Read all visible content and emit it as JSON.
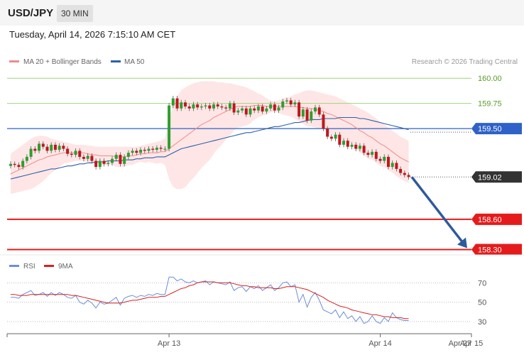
{
  "header": {
    "symbol": "USD/JPY",
    "timeframe": "30 MIN",
    "datetime": "Tuesday, April 14, 2026 7:15:10 AM CET"
  },
  "legend": {
    "ma20_label": "MA 20 + Bollinger Bands",
    "ma50_label": "MA 50",
    "copyright": "Research © 2026 Trading Central",
    "rsi_label": "RSI",
    "rsi_ma_label": "9MA"
  },
  "colors": {
    "ma20": "#f08a8a",
    "ma50": "#2e5fa8",
    "band_fill": "#fddede",
    "bull": "#2e9e2e",
    "bear": "#c0161c",
    "resistance": "#9ed47e",
    "pivot": "#2f62c8",
    "support": "#e51b1b",
    "last_price": "#333333",
    "arrow": "#2e5a9c",
    "rsi": "#6a8fd8",
    "rsi_ma": "#d92020"
  },
  "chart_data": [
    {
      "type": "candlestick",
      "symbol": "USD/JPY",
      "timeframe": "30 MIN",
      "y_ticks": [
        160.0,
        159.75,
        159.5,
        159.02,
        158.6,
        158.3
      ],
      "ylim": [
        158.24,
        160.1
      ],
      "levels": [
        {
          "value": 160.0,
          "kind": "resistance",
          "label": "160.00"
        },
        {
          "value": 159.75,
          "kind": "resistance",
          "label": "159.75"
        },
        {
          "value": 159.5,
          "kind": "pivot",
          "label": "159.50"
        },
        {
          "value": 159.02,
          "kind": "last",
          "label": "159.02"
        },
        {
          "value": 158.6,
          "kind": "support",
          "label": "158.60"
        },
        {
          "value": 158.3,
          "kind": "support",
          "label": "158.30"
        }
      ],
      "x_tick_labels": [
        "Apr 13",
        "Apr 14",
        "Apr 15",
        "Apr 27"
      ],
      "x_tick_bar_index": [
        39,
        91,
        105,
        119
      ],
      "closes": [
        159.15,
        159.14,
        159.12,
        159.18,
        159.22,
        159.3,
        159.28,
        159.35,
        159.32,
        159.28,
        159.34,
        159.29,
        159.33,
        159.3,
        159.25,
        159.24,
        159.28,
        159.22,
        159.2,
        159.23,
        159.18,
        159.12,
        159.18,
        159.15,
        159.16,
        159.2,
        159.24,
        159.15,
        159.22,
        159.26,
        159.28,
        159.26,
        159.29,
        159.28,
        159.3,
        159.29,
        159.31,
        159.3,
        159.3,
        159.73,
        159.8,
        159.7,
        159.76,
        159.72,
        159.7,
        159.74,
        159.71,
        159.72,
        159.73,
        159.7,
        159.74,
        159.72,
        159.71,
        159.7,
        159.75,
        159.66,
        159.68,
        159.7,
        159.64,
        159.7,
        159.68,
        159.72,
        159.67,
        159.7,
        159.74,
        159.68,
        159.71,
        159.77,
        159.78,
        159.74,
        159.76,
        159.62,
        159.69,
        159.58,
        159.67,
        159.71,
        159.64,
        159.5,
        159.42,
        159.4,
        159.44,
        159.34,
        159.38,
        159.32,
        159.34,
        159.3,
        159.33,
        159.26,
        159.24,
        159.27,
        159.2,
        159.18,
        159.22,
        159.12,
        159.16,
        159.1,
        159.06,
        159.04,
        159.02
      ],
      "ma20": [
        159.05,
        159.07,
        159.09,
        159.11,
        159.13,
        159.15,
        159.17,
        159.19,
        159.2,
        159.22,
        159.23,
        159.24,
        159.25,
        159.26,
        159.26,
        159.26,
        159.26,
        159.26,
        159.26,
        159.25,
        159.24,
        159.24,
        159.23,
        159.23,
        159.23,
        159.23,
        159.22,
        159.22,
        159.22,
        159.23,
        159.23,
        159.24,
        159.25,
        159.25,
        159.26,
        159.26,
        159.26,
        159.27,
        159.27,
        159.3,
        159.33,
        159.36,
        159.39,
        159.42,
        159.45,
        159.48,
        159.51,
        159.54,
        159.56,
        159.58,
        159.61,
        159.63,
        159.65,
        159.67,
        159.69,
        159.71,
        159.72,
        159.72,
        159.72,
        159.72,
        159.73,
        159.73,
        159.73,
        159.72,
        159.72,
        159.72,
        159.72,
        159.72,
        159.72,
        159.72,
        159.72,
        159.71,
        159.71,
        159.7,
        159.7,
        159.69,
        159.68,
        159.67,
        159.65,
        159.64,
        159.62,
        159.6,
        159.58,
        159.56,
        159.54,
        159.51,
        159.48,
        159.46,
        159.43,
        159.41,
        159.38,
        159.35,
        159.33,
        159.3,
        159.27,
        159.24,
        159.21,
        159.19,
        159.17
      ],
      "upper_band": [
        159.25,
        159.28,
        159.31,
        159.34,
        159.37,
        159.4,
        159.42,
        159.43,
        159.43,
        159.42,
        159.4,
        159.39,
        159.38,
        159.37,
        159.36,
        159.35,
        159.34,
        159.34,
        159.34,
        159.33,
        159.33,
        159.32,
        159.32,
        159.32,
        159.32,
        159.32,
        159.32,
        159.32,
        159.32,
        159.32,
        159.32,
        159.32,
        159.33,
        159.34,
        159.35,
        159.36,
        159.37,
        159.38,
        159.4,
        159.6,
        159.74,
        159.82,
        159.88,
        159.91,
        159.93,
        159.95,
        159.96,
        159.97,
        159.97,
        159.97,
        159.97,
        159.96,
        159.96,
        159.95,
        159.95,
        159.94,
        159.93,
        159.92,
        159.91,
        159.89,
        159.87,
        159.85,
        159.83,
        159.8,
        159.78,
        159.77,
        159.78,
        159.8,
        159.81,
        159.82,
        159.84,
        159.85,
        159.87,
        159.88,
        159.88,
        159.87,
        159.86,
        159.85,
        159.84,
        159.83,
        159.82,
        159.8,
        159.78,
        159.76,
        159.74,
        159.72,
        159.7,
        159.68,
        159.66,
        159.63,
        159.6,
        159.57,
        159.54,
        159.51,
        159.48,
        159.45,
        159.42,
        159.4,
        159.38
      ],
      "lower_band": [
        158.85,
        158.86,
        158.87,
        158.88,
        158.89,
        158.9,
        158.92,
        158.95,
        158.98,
        159.02,
        159.06,
        159.09,
        159.12,
        159.15,
        159.16,
        159.17,
        159.18,
        159.18,
        159.18,
        159.17,
        159.15,
        159.16,
        159.14,
        159.14,
        159.14,
        159.14,
        159.12,
        159.12,
        159.12,
        159.14,
        159.14,
        159.16,
        159.17,
        159.16,
        159.17,
        159.16,
        159.15,
        159.16,
        159.14,
        159.0,
        158.92,
        158.9,
        158.9,
        158.92,
        158.97,
        159.01,
        159.06,
        159.11,
        159.15,
        159.19,
        159.25,
        159.3,
        159.34,
        159.39,
        159.43,
        159.48,
        159.51,
        159.52,
        159.53,
        159.55,
        159.59,
        159.61,
        159.63,
        159.64,
        159.66,
        159.67,
        159.66,
        159.64,
        159.63,
        159.62,
        159.6,
        159.57,
        159.55,
        159.52,
        159.52,
        159.51,
        159.5,
        159.49,
        159.46,
        159.45,
        159.42,
        159.4,
        159.38,
        159.36,
        159.34,
        159.3,
        159.26,
        159.24,
        159.2,
        159.19,
        159.16,
        159.13,
        159.12,
        159.09,
        159.06,
        159.03,
        159.0,
        158.98,
        158.96
      ],
      "ma50": [
        159.0,
        159.01,
        159.02,
        159.03,
        159.04,
        159.05,
        159.06,
        159.07,
        159.08,
        159.09,
        159.1,
        159.1,
        159.11,
        159.12,
        159.13,
        159.13,
        159.14,
        159.15,
        159.15,
        159.16,
        159.16,
        159.17,
        159.17,
        159.17,
        159.18,
        159.18,
        159.18,
        159.18,
        159.19,
        159.19,
        159.19,
        159.2,
        159.2,
        159.21,
        159.21,
        159.21,
        159.22,
        159.22,
        159.22,
        159.24,
        159.26,
        159.28,
        159.3,
        159.31,
        159.32,
        159.33,
        159.34,
        159.35,
        159.36,
        159.37,
        159.38,
        159.39,
        159.4,
        159.41,
        159.42,
        159.43,
        159.44,
        159.45,
        159.46,
        159.46,
        159.47,
        159.48,
        159.49,
        159.5,
        159.51,
        159.52,
        159.52,
        159.53,
        159.54,
        159.55,
        159.56,
        159.56,
        159.57,
        159.58,
        159.59,
        159.59,
        159.59,
        159.6,
        159.6,
        159.6,
        159.6,
        159.61,
        159.61,
        159.61,
        159.61,
        159.61,
        159.6,
        159.6,
        159.59,
        159.58,
        159.57,
        159.56,
        159.55,
        159.54,
        159.53,
        159.52,
        159.51,
        159.5,
        159.49
      ],
      "forecast_arrow": {
        "from": 159.02,
        "to": 158.3
      }
    },
    {
      "type": "line",
      "title": "RSI",
      "y_ticks": [
        70,
        50,
        30
      ],
      "ylim": [
        24,
        82
      ],
      "series": [
        {
          "name": "RSI",
          "values": [
            55,
            55,
            54,
            58,
            60,
            62,
            57,
            58,
            60,
            56,
            60,
            57,
            60,
            58,
            55,
            54,
            57,
            50,
            48,
            52,
            49,
            44,
            50,
            48,
            49,
            52,
            55,
            47,
            54,
            56,
            57,
            55,
            57,
            56,
            58,
            57,
            59,
            58,
            58,
            76,
            76,
            72,
            74,
            71,
            70,
            72,
            70,
            71,
            72,
            68,
            71,
            70,
            69,
            68,
            71,
            62,
            65,
            66,
            61,
            66,
            64,
            67,
            62,
            65,
            68,
            62,
            65,
            70,
            71,
            66,
            68,
            50,
            58,
            45,
            55,
            60,
            52,
            42,
            40,
            38,
            42,
            34,
            40,
            33,
            36,
            30,
            35,
            28,
            30,
            36,
            30,
            28,
            34,
            30,
            39,
            34,
            32,
            31,
            31
          ]
        },
        {
          "name": "9MA",
          "values": [
            58,
            58,
            57,
            57,
            57,
            58,
            58,
            58,
            58,
            58,
            58,
            58,
            58,
            58,
            58,
            57,
            57,
            56,
            55,
            54,
            53,
            52,
            51,
            50,
            49,
            49,
            49,
            49,
            50,
            51,
            52,
            52,
            53,
            54,
            55,
            55,
            55,
            56,
            56,
            58,
            60,
            62,
            64,
            65,
            67,
            68,
            70,
            71,
            71,
            71,
            71,
            70,
            70,
            70,
            70,
            69,
            68,
            67,
            67,
            66,
            66,
            65,
            65,
            65,
            65,
            64,
            64,
            65,
            66,
            66,
            66,
            65,
            64,
            63,
            61,
            59,
            57,
            55,
            52,
            50,
            48,
            46,
            45,
            44,
            42,
            41,
            40,
            39,
            38,
            37,
            37,
            36,
            35,
            35,
            34,
            34,
            34,
            33,
            33
          ]
        }
      ]
    }
  ]
}
